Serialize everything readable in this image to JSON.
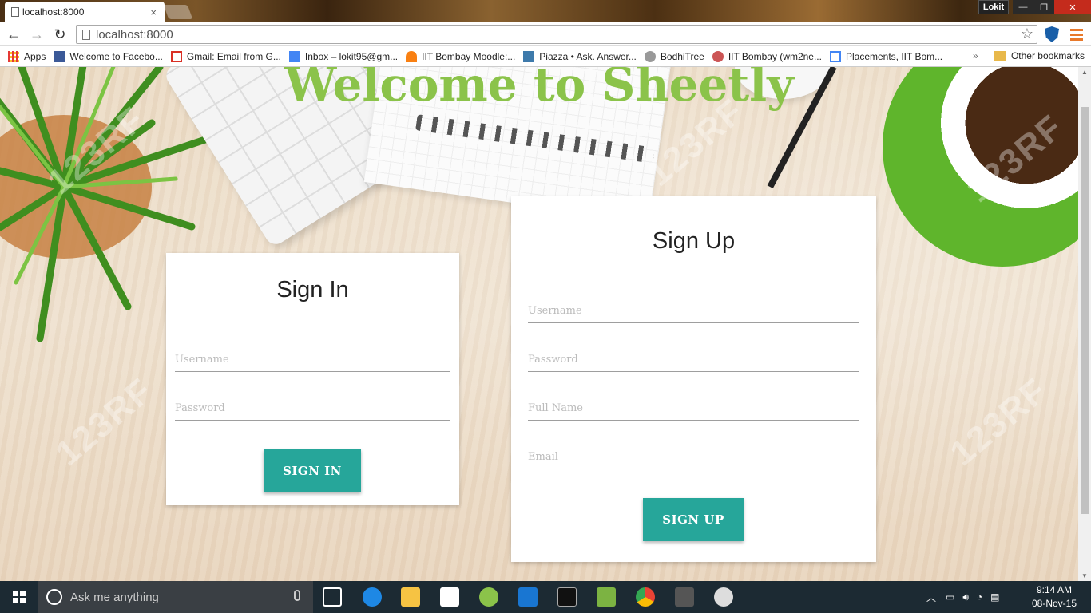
{
  "browser": {
    "tab_title": "localhost:8000",
    "tab_close": "×",
    "profile_name": "Lokit",
    "window_minimize": "—",
    "window_restore": "❐",
    "window_close": "✕",
    "nav_back": "←",
    "nav_forward": "→",
    "nav_reload": "↻",
    "url": "localhost:8000",
    "star": "☆",
    "bookmarks": [
      {
        "label": "Apps",
        "icon": "apps-grid-icon",
        "color": "#e53935"
      },
      {
        "label": "Welcome to Facebo...",
        "icon": "facebook-icon",
        "color": "#3b5998"
      },
      {
        "label": "Gmail: Email from G...",
        "icon": "gmail-icon",
        "color": "#d93025"
      },
      {
        "label": "Inbox – lokit95@gm...",
        "icon": "inbox-icon",
        "color": "#4285f4"
      },
      {
        "label": "IIT Bombay Moodle:...",
        "icon": "moodle-icon",
        "color": "#f98012"
      },
      {
        "label": "Piazza • Ask. Answer...",
        "icon": "piazza-icon",
        "color": "#3e7aab"
      },
      {
        "label": "BodhiTree",
        "icon": "bodhitree-icon",
        "color": "#777777"
      },
      {
        "label": "IIT Bombay (wm2ne...",
        "icon": "iitb-icon",
        "color": "#a33"
      },
      {
        "label": "Placements, IIT Bom...",
        "icon": "document-icon",
        "color": "#4285f4"
      }
    ],
    "bookmarks_more": "»",
    "other_bookmarks": "Other bookmarks"
  },
  "page": {
    "heading": "Welcome to Sheetly",
    "watermark": "123RF",
    "signin": {
      "title": "Sign In",
      "username_placeholder": "Username",
      "password_placeholder": "Password",
      "button": "SIGN IN"
    },
    "signup": {
      "title": "Sign Up",
      "username_placeholder": "Username",
      "password_placeholder": "Password",
      "fullname_placeholder": "Full Name",
      "email_placeholder": "Email",
      "button": "SIGN UP"
    }
  },
  "taskbar": {
    "search_placeholder": "Ask me anything",
    "time": "9:14 AM",
    "date": "08-Nov-15"
  },
  "colors": {
    "heading_green": "#8bc34a",
    "button_teal": "#26a69a"
  }
}
